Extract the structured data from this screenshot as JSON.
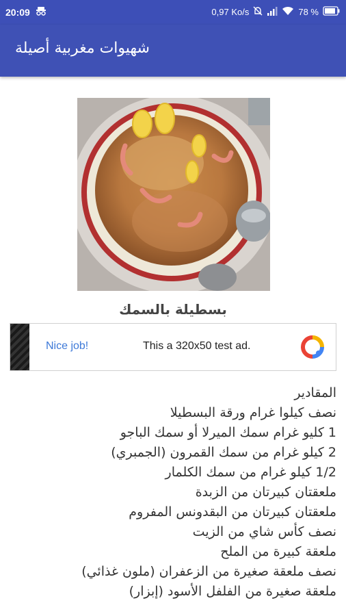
{
  "status_bar": {
    "time": "20:09",
    "network_speed": "0,97 Ko/s",
    "battery": "78 %",
    "icons": [
      "incognito-icon",
      "mute-icon",
      "signal-icon",
      "wifi-icon",
      "battery-icon"
    ]
  },
  "app_bar": {
    "title": "شهيوات مغربية أصيلة",
    "color": "#3f51b5"
  },
  "recipe": {
    "title": "بسطيلة بالسمك",
    "image_icon": "fish-pastilla-photo"
  },
  "ad": {
    "left_text": "Nice job!",
    "right_text": "This a 320x50 test ad."
  },
  "ingredients": [
    "المقادير",
    "نصف كيلوا غرام ورقة البسطيلا",
    "1 كليو غرام سمك الميرلا أو سمك الباجو",
    "2 كيلو غرام من سمك القمرون (الجمبري)",
    "1/2 كيلو غرام من سمك الكلمار",
    "ملعقتان كبيرتان من الزبدة",
    "ملعقتان كبيرتان من البقدونس المفروم",
    "نصف كأس شاي من الزيت",
    "ملعقة كبيرة من الملح",
    "نصف ملعقة صغيرة من الزعفران (ملون غذائي)",
    "ملعقة صغيرة من الفلفل الأسود (إبزار)"
  ]
}
